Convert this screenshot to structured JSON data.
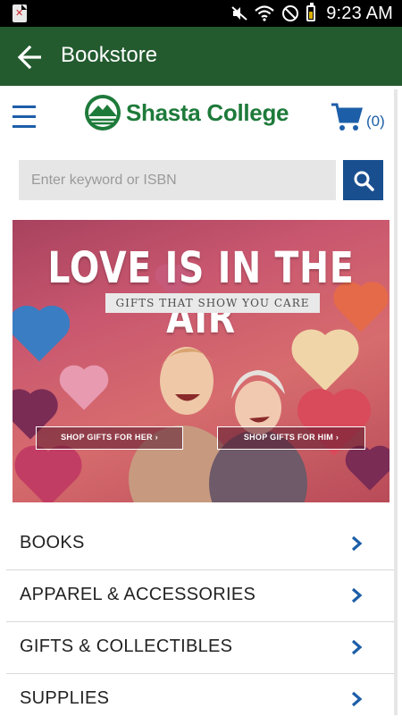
{
  "status_bar": {
    "time": "9:23 AM",
    "notification_icon": "app-error-icon",
    "icons": [
      "mute-icon",
      "wifi-icon",
      "no-sim-icon",
      "battery-icon"
    ]
  },
  "app_bar": {
    "back_icon": "arrow-left-icon",
    "title": "Bookstore",
    "color": "#235b2f"
  },
  "header": {
    "menu_icon": "hamburger-icon",
    "logo_text": "Shasta College",
    "cart_icon": "shopping-cart-icon",
    "cart_count": "(0)",
    "accent": "#1d5ea8"
  },
  "search": {
    "placeholder": "Enter keyword or ISBN",
    "value": "",
    "button_icon": "search-icon"
  },
  "banner": {
    "title": "LOVE IS IN THE AIR",
    "subtitle": "GIFTS THAT SHOW YOU CARE",
    "btn_her": "SHOP GIFTS FOR HER ›",
    "btn_him": "SHOP GIFTS FOR HIM ›"
  },
  "categories": [
    {
      "label": "BOOKS"
    },
    {
      "label": "APPAREL & ACCESSORIES"
    },
    {
      "label": "GIFTS & COLLECTIBLES"
    },
    {
      "label": "SUPPLIES"
    }
  ]
}
